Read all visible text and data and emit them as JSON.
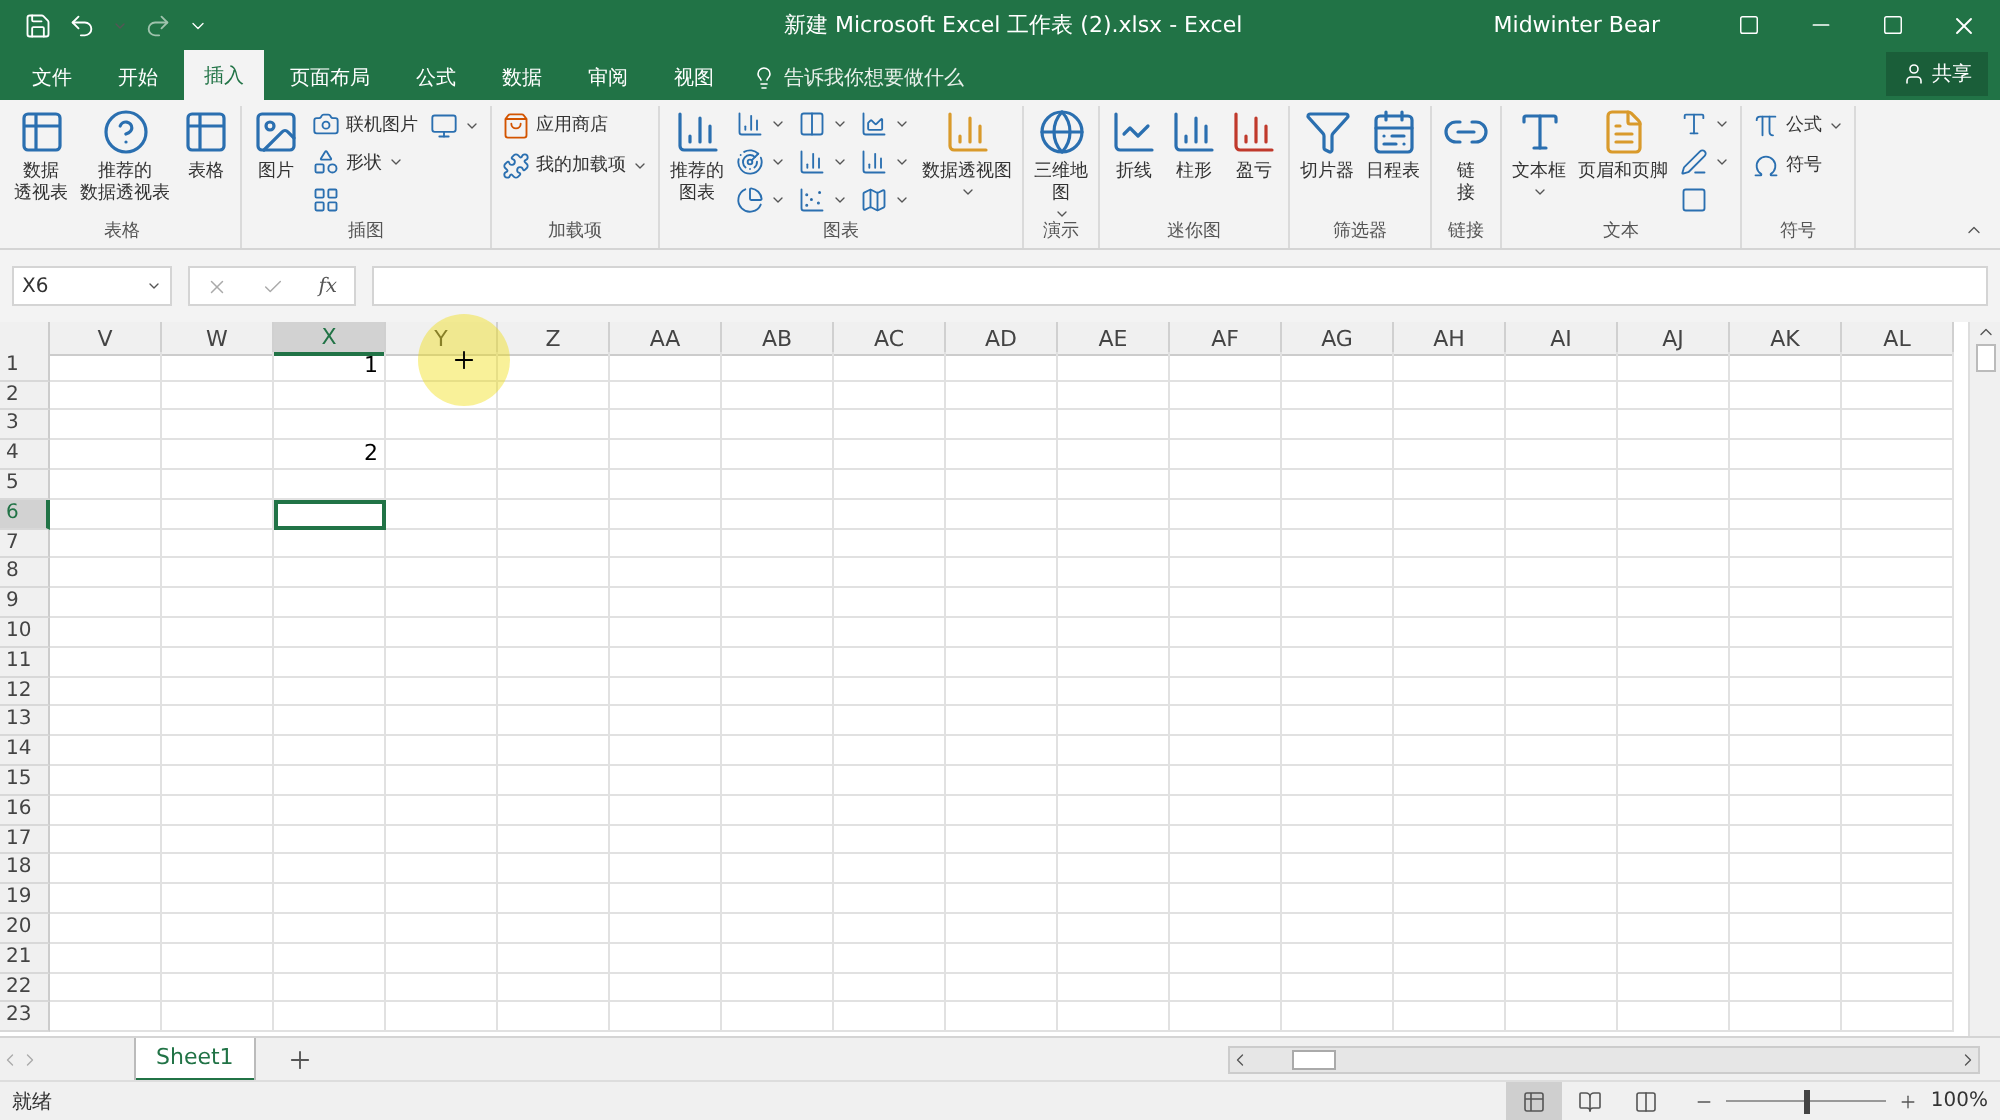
{
  "title_bar": {
    "title": "新建 Microsoft Excel 工作表 (2).xlsx  -  Excel",
    "user": "Midwinter Bear"
  },
  "tabs": [
    {
      "label": "文件",
      "selected": false
    },
    {
      "label": "开始",
      "selected": false
    },
    {
      "label": "插入",
      "selected": true
    },
    {
      "label": "页面布局",
      "selected": false
    },
    {
      "label": "公式",
      "selected": false
    },
    {
      "label": "数据",
      "selected": false
    },
    {
      "label": "审阅",
      "selected": false
    },
    {
      "label": "视图",
      "selected": false
    }
  ],
  "tell_me": {
    "placeholder": "告诉我你想要做什么"
  },
  "share": "共享",
  "ribbon": {
    "groups": [
      {
        "label": "表格",
        "columns": [
          [
            {
              "kind": "large",
              "lines": [
                "数据",
                "透视表"
              ]
            }
          ],
          [
            {
              "kind": "large",
              "lines": [
                "推荐的",
                "数据透视表"
              ]
            }
          ],
          [
            {
              "kind": "large",
              "lines": [
                "表格"
              ]
            }
          ]
        ]
      },
      {
        "label": "插图",
        "columns": [
          [
            {
              "kind": "large",
              "lines": [
                "图片"
              ]
            }
          ],
          [
            {
              "kind": "small",
              "lines": [
                "联机图片"
              ]
            },
            {
              "kind": "small",
              "lines": [
                "形状"
              ],
              "dropdown": true
            },
            {
              "kind": "icon"
            }
          ],
          [
            {
              "kind": "icon",
              "dropdown": true
            }
          ]
        ]
      },
      {
        "label": "加载项",
        "columns": [
          [
            {
              "kind": "small",
              "lines": [
                "应用商店"
              ]
            },
            {
              "kind": "small",
              "lines": [
                "我的加载项"
              ],
              "dropdown": true
            }
          ]
        ]
      },
      {
        "label": "图表",
        "columns": [
          [
            {
              "kind": "large",
              "lines": [
                "推荐的",
                "图表"
              ]
            }
          ],
          [
            {
              "kind": "icon",
              "dropdown": true
            },
            {
              "kind": "icon",
              "dropdown": true
            },
            {
              "kind": "icon",
              "dropdown": true
            }
          ],
          [
            {
              "kind": "icon",
              "dropdown": true
            },
            {
              "kind": "icon",
              "dropdown": true
            },
            {
              "kind": "icon",
              "dropdown": true
            }
          ],
          [
            {
              "kind": "icon",
              "dropdown": true
            },
            {
              "kind": "icon",
              "dropdown": true
            },
            {
              "kind": "icon",
              "dropdown": true
            }
          ],
          [
            {
              "kind": "large",
              "lines": [
                "数据透视图"
              ],
              "dropdown": true
            }
          ]
        ]
      },
      {
        "label": "演示",
        "columns": [
          [
            {
              "kind": "large",
              "lines": [
                "三维地",
                "图"
              ],
              "dropdown": true
            }
          ]
        ]
      },
      {
        "label": "迷你图",
        "columns": [
          [
            {
              "kind": "large",
              "lines": [
                "折线"
              ]
            }
          ],
          [
            {
              "kind": "large",
              "lines": [
                "柱形"
              ]
            }
          ],
          [
            {
              "kind": "large",
              "lines": [
                "盈亏"
              ]
            }
          ]
        ]
      },
      {
        "label": "筛选器",
        "columns": [
          [
            {
              "kind": "large",
              "lines": [
                "切片器"
              ]
            }
          ],
          [
            {
              "kind": "large",
              "lines": [
                "日程表"
              ]
            }
          ]
        ]
      },
      {
        "label": "链接",
        "columns": [
          [
            {
              "kind": "large",
              "lines": [
                "链",
                "接"
              ]
            }
          ]
        ]
      },
      {
        "label": "文本",
        "columns": [
          [
            {
              "kind": "large",
              "lines": [
                "文本框"
              ],
              "dropdown": true
            }
          ],
          [
            {
              "kind": "large",
              "lines": [
                "页眉和页脚"
              ]
            }
          ],
          [
            {
              "kind": "icon",
              "dropdown": true
            },
            {
              "kind": "icon",
              "dropdown": true
            },
            {
              "kind": "icon"
            }
          ]
        ]
      },
      {
        "label": "符号",
        "columns": [
          [
            {
              "kind": "small",
              "lines": [
                "公式"
              ],
              "dropdown": true
            },
            {
              "kind": "small",
              "lines": [
                "符号"
              ]
            }
          ]
        ]
      }
    ]
  },
  "formula_bar": {
    "name_box": "X6",
    "fx": "fx"
  },
  "grid": {
    "columns": [
      {
        "label": "V",
        "selected": false
      },
      {
        "label": "W",
        "selected": false
      },
      {
        "label": "X",
        "selected": true
      },
      {
        "label": "Y",
        "selected": false
      },
      {
        "label": "Z",
        "selected": false
      },
      {
        "label": "AA",
        "selected": false
      },
      {
        "label": "AB",
        "selected": false
      },
      {
        "label": "AC",
        "selected": false
      },
      {
        "label": "AD",
        "selected": false
      },
      {
        "label": "AE",
        "selected": false
      },
      {
        "label": "AF",
        "selected": false
      },
      {
        "label": "AG",
        "selected": false
      },
      {
        "label": "AH",
        "selected": false
      },
      {
        "label": "AI",
        "selected": false
      },
      {
        "label": "AJ",
        "selected": false
      },
      {
        "label": "AK",
        "selected": false
      },
      {
        "label": "AL",
        "selected": false
      }
    ],
    "rows": [
      {
        "number": "1",
        "selected": false,
        "cells": [
          {},
          {},
          {
            "value": "1"
          }
        ]
      },
      {
        "number": "2",
        "selected": false
      },
      {
        "number": "3",
        "selected": false
      },
      {
        "number": "4",
        "selected": false,
        "cells": [
          {},
          {},
          {
            "value": "2"
          }
        ]
      },
      {
        "number": "5",
        "selected": false
      },
      {
        "number": "6",
        "selected": true
      },
      {
        "number": "7",
        "selected": false
      },
      {
        "number": "8",
        "selected": false
      },
      {
        "number": "9",
        "selected": false
      },
      {
        "number": "10",
        "selected": false
      },
      {
        "number": "11",
        "selected": false
      },
      {
        "number": "12",
        "selected": false
      },
      {
        "number": "13",
        "selected": false
      },
      {
        "number": "14",
        "selected": false
      },
      {
        "number": "15",
        "selected": false
      },
      {
        "number": "16",
        "selected": false
      },
      {
        "number": "17",
        "selected": false
      },
      {
        "number": "18",
        "selected": false
      },
      {
        "number": "19",
        "selected": false
      },
      {
        "number": "20",
        "selected": false
      },
      {
        "number": "21",
        "selected": false
      },
      {
        "number": "22",
        "selected": false
      },
      {
        "number": "23",
        "selected": false
      }
    ]
  },
  "sheets": [
    {
      "label": "Sheet1",
      "selected": true
    }
  ],
  "status_bar": {
    "status": "就绪",
    "views": [
      {
        "selected": true
      },
      {
        "selected": false
      },
      {
        "selected": false
      }
    ],
    "zoom": {
      "level": 0.5,
      "reading": "100%"
    }
  }
}
